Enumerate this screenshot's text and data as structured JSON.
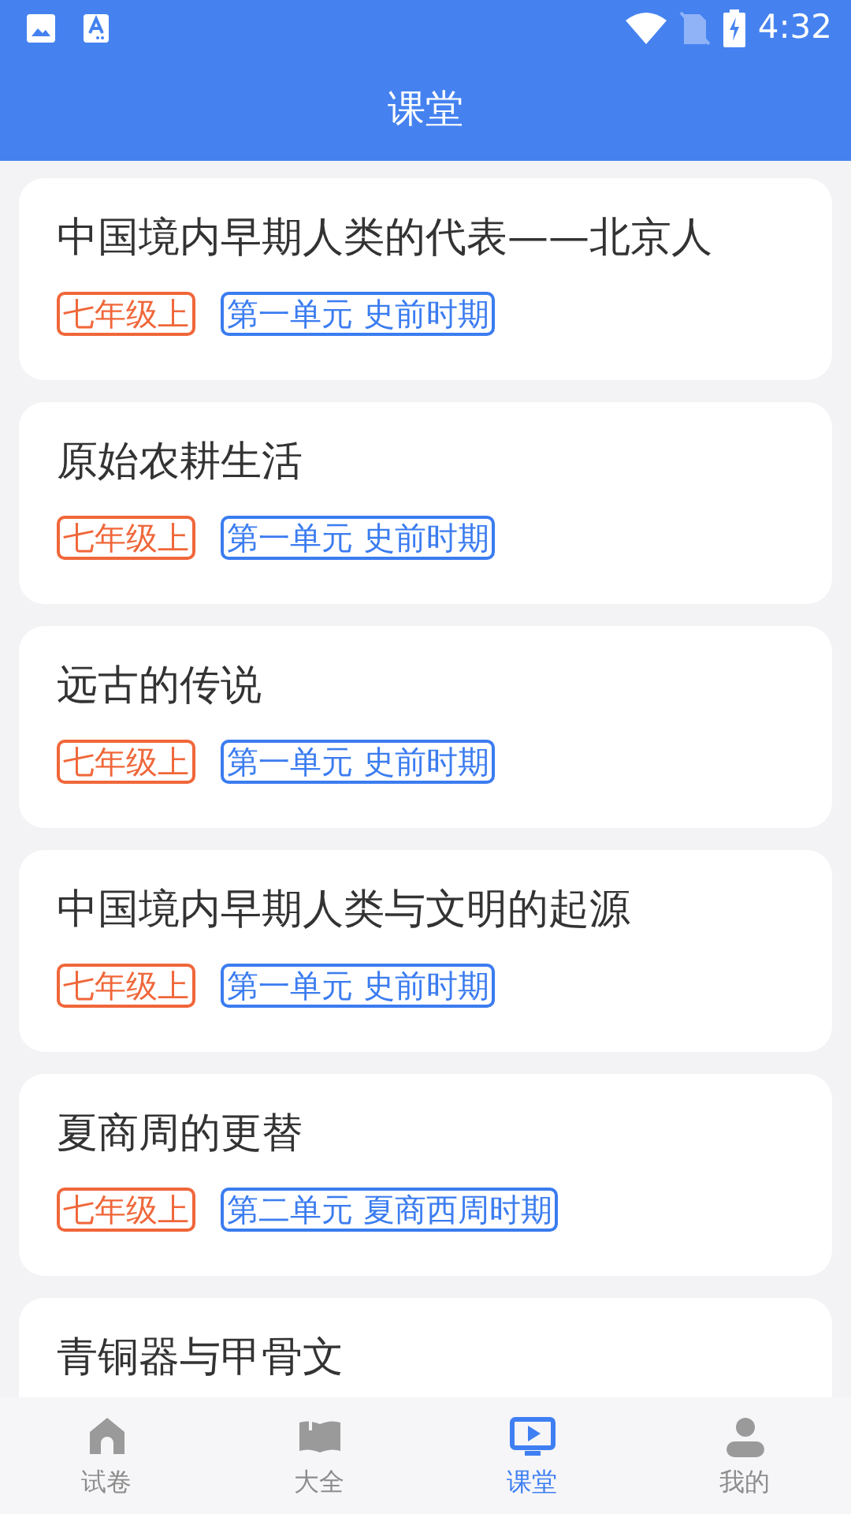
{
  "status_bar": {
    "time": "4:32"
  },
  "header": {
    "title": "课堂"
  },
  "lessons": [
    {
      "title": "中国境内早期人类的代表——北京人",
      "grade": "七年级上",
      "unit": "第一单元 史前时期"
    },
    {
      "title": "原始农耕生活",
      "grade": "七年级上",
      "unit": "第一单元 史前时期"
    },
    {
      "title": "远古的传说",
      "grade": "七年级上",
      "unit": "第一单元 史前时期"
    },
    {
      "title": "中国境内早期人类与文明的起源",
      "grade": "七年级上",
      "unit": "第一单元 史前时期"
    },
    {
      "title": "夏商周的更替",
      "grade": "七年级上",
      "unit": "第二单元 夏商西周时期"
    },
    {
      "title": "青铜器与甲骨文"
    }
  ],
  "bottom_nav": [
    {
      "label": "试卷",
      "kind": "home",
      "selected": false
    },
    {
      "label": "大全",
      "kind": "book",
      "selected": false
    },
    {
      "label": "课堂",
      "kind": "video",
      "selected": true
    },
    {
      "label": "我的",
      "kind": "person",
      "selected": false
    }
  ]
}
